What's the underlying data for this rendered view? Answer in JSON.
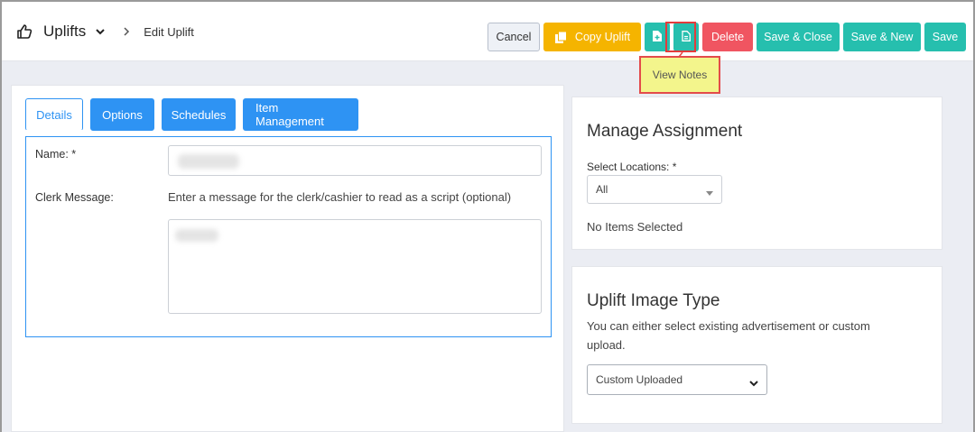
{
  "header": {
    "title": "Uplifts",
    "breadcrumb_current": "Edit Uplift"
  },
  "toolbar": {
    "cancel_label": "Cancel",
    "copy_label": "Copy Uplift",
    "delete_label": "Delete",
    "save_close_label": "Save & Close",
    "save_new_label": "Save & New",
    "save_label": "Save",
    "tooltip": "View Notes"
  },
  "tabs": [
    {
      "label": "Details",
      "active": true
    },
    {
      "label": "Options",
      "active": false
    },
    {
      "label": "Schedules",
      "active": false
    },
    {
      "label": "Item Management",
      "active": false
    }
  ],
  "form": {
    "name_label": "Name: *",
    "clerk_label": "Clerk Message:",
    "clerk_hint": "Enter a message for the clerk/cashier to read as a script (optional)"
  },
  "assignment": {
    "title": "Manage Assignment",
    "locations_label": "Select Locations: *",
    "locations_value": "All",
    "empty_text": "No Items Selected"
  },
  "image_type": {
    "title": "Uplift Image Type",
    "description": "You can either select existing advertisement or custom upload.",
    "select_value": "Custom Uploaded"
  },
  "colors": {
    "teal": "#26bfae",
    "blue": "#2e93f3",
    "yellow": "#f5b400",
    "red": "#f05561"
  }
}
